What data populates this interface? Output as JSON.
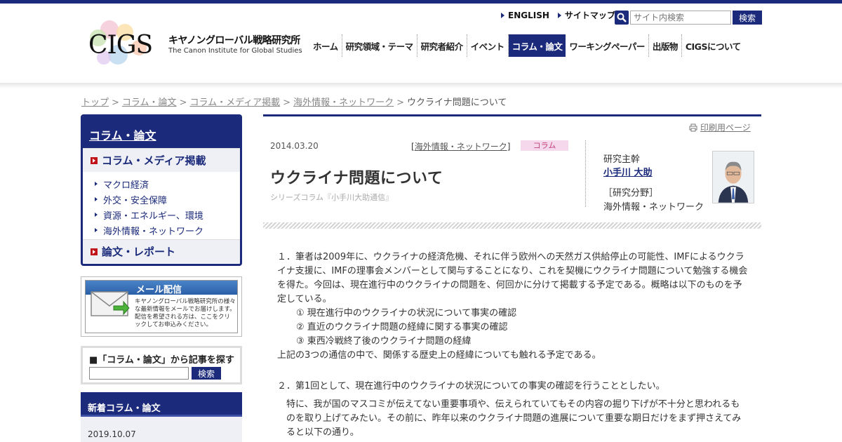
{
  "header": {
    "logo_text": "CIGS",
    "org_name_jp": "キヤノングローバル戦略研究所",
    "org_name_en": "The Canon Institute for Global Studies",
    "utility_links": [
      "ENGLISH",
      "サイトマップ"
    ],
    "search_placeholder": "サイト内検索",
    "search_button": "検索",
    "nav": [
      "ホーム",
      "研究領域・テーマ",
      "研究者紹介",
      "イベント",
      "コラム・論文",
      "ワーキングペーパー",
      "出版物",
      "CIGSについて"
    ],
    "nav_active": "コラム・論文"
  },
  "breadcrumb": {
    "items": [
      "トップ",
      "コラム・論文",
      "コラム・メディア掲載",
      "海外情報・ネットワーク"
    ],
    "separator": ">",
    "current": "ウクライナ問題について"
  },
  "sidebar": {
    "title": "コラム・論文",
    "section1": "コラム・メディア掲載",
    "items": [
      "マクロ経済",
      "外交・安全保障",
      "資源・エネルギー、環境",
      "海外情報・ネットワーク"
    ],
    "section2": "論文・レポート",
    "mail_banner": {
      "title": "メール配信",
      "text": "キヤノングローバル戦略研究所の様々な最新情報をメールでお届けします。配信を希望される方は、ここをクリックしてお申込みください。"
    },
    "find": {
      "title": "■「コラム・論文」から記事を探す",
      "button": "検索"
    },
    "new_title": "新着コラム・論文",
    "new_date": "2019.10.07"
  },
  "article": {
    "print_label": "印刷用ページ",
    "date": "2014.03.20",
    "category": "海外情報・ネットワーク",
    "tag": "コラム",
    "title": "ウクライナ問題について",
    "series": "シリーズコラム『小手川大助通信』",
    "author_role": "研究主幹",
    "author_name": "小手川 大助",
    "field_label": "［研究分野］",
    "field_value": "海外情報・ネットワーク",
    "body": {
      "p1": "１．筆者は2009年に、ウクライナの経済危機、それに伴う欧州への天然ガス供給停止の可能性、IMFによるウクライナ支援に、IMFの理事会メンバーとして関与することになり、これを契機にウクライナ問題について勉強する機会を得た。今回は、現在進行中のウクライナの問題を、何回かに分けて掲載する予定である。概略は以下のものを予定している。",
      "list": [
        "① 現在進行中のウクライナの状況について事実の確認",
        "② 直近のウクライナ問題の経緯に関する事実の確認",
        "③ 東西冷戦終了後のウクライナ問題の経緯"
      ],
      "p2": "上記の3つの通信の中で、関係する歴史上の経緯についても触れる予定である。",
      "p3": "２．第1回として、現在進行中のウクライナの状況についての事実の確認を行うこととしたい。",
      "p4": "特に、我が国のマスコミが伝えてない重要事項や、伝えられていてもその内容の掘り下げが不十分と思われるものを取り上げてみたい。その前に、昨年以来のウクライナ問題の進展について重要な期日だけをまず押さえてみると以下の通り。"
    }
  },
  "colors": {
    "navy": "#1b2a7a",
    "accent_red": "#c0141b",
    "tag_bg": "#f6d8ec",
    "tag_text": "#c0437e"
  }
}
